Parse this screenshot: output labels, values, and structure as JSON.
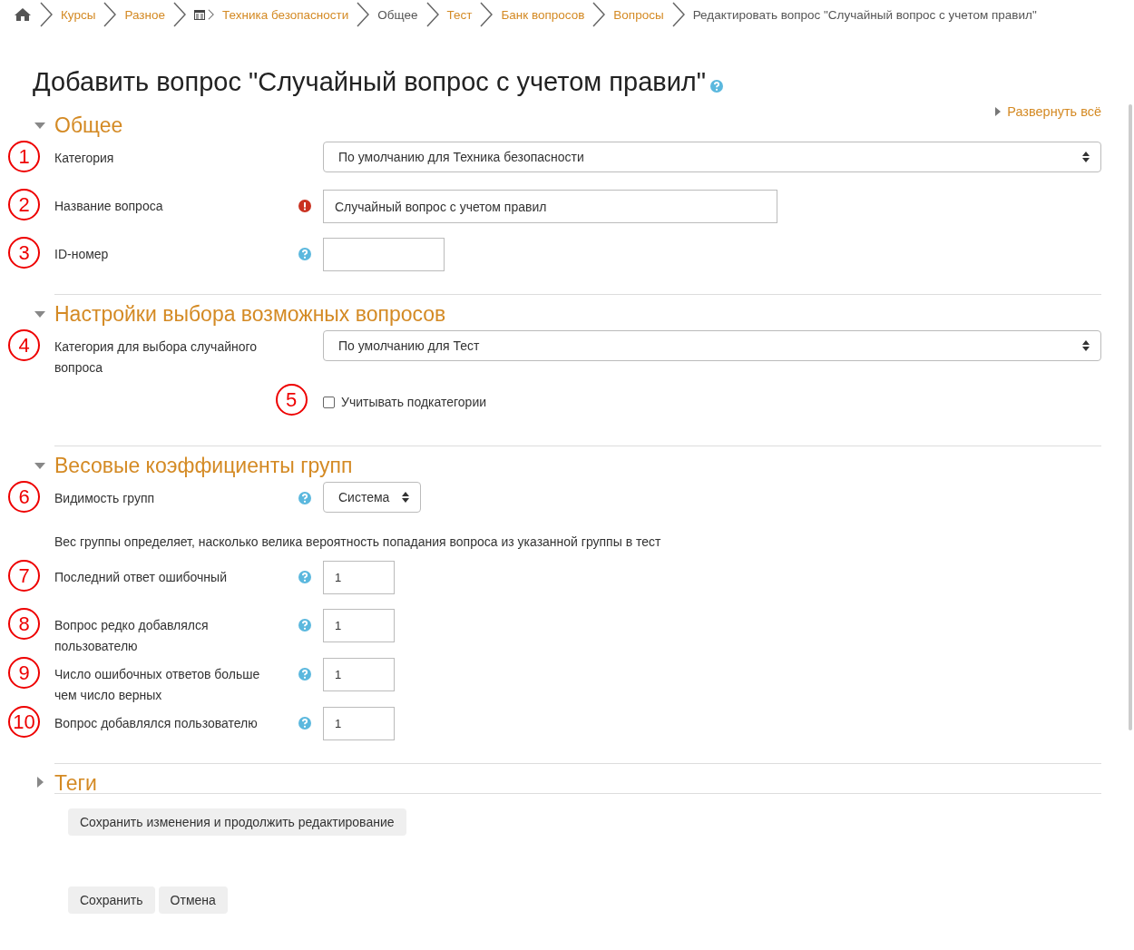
{
  "breadcrumb": [
    {
      "kind": "home"
    },
    {
      "kind": "link",
      "label": "Курсы"
    },
    {
      "kind": "link",
      "label": "Разное"
    },
    {
      "kind": "course",
      "label": "Техника безопасности"
    },
    {
      "kind": "text",
      "label": "Общее"
    },
    {
      "kind": "link",
      "label": "Тест"
    },
    {
      "kind": "link",
      "label": "Банк вопросов"
    },
    {
      "kind": "link",
      "label": "Вопросы"
    },
    {
      "kind": "text",
      "label": "Редактировать вопрос \"Случайный вопрос с учетом правил\""
    }
  ],
  "page_title": "Добавить вопрос \"Случайный вопрос с учетом правил\"",
  "expand_all": "Развернуть всё",
  "sections": [
    {
      "title": "Общее",
      "expanded": true,
      "rows": [
        {
          "kind": "select",
          "marker": "1",
          "label": "Категория",
          "value": "По умолчанию для Техника безопасности"
        },
        {
          "kind": "textfield",
          "marker": "2",
          "label": "Название вопроса",
          "required": true,
          "value": "Случайный вопрос с учетом правил"
        },
        {
          "kind": "idfield",
          "marker": "3",
          "label": "ID-номер",
          "help": true
        }
      ]
    },
    {
      "title": "Настройки выбора возможных вопросов",
      "expanded": true,
      "rows": [
        {
          "kind": "select",
          "marker": "4",
          "label": "Категория для выбора случайного вопроса",
          "value": "По умолчанию для Тест"
        },
        {
          "kind": "checkbox",
          "marker": "5",
          "label": "Учитывать подкатегории",
          "checked": false
        }
      ]
    },
    {
      "title": "Весовые коэффициенты групп",
      "expanded": true,
      "rows": [
        {
          "kind": "picker",
          "marker": "6",
          "label": "Видимость групп",
          "help": true,
          "value": "Система"
        },
        {
          "kind": "note",
          "label": "Вес группы определяет, насколько велика вероятность попадания вопроса из указанной группы в тест"
        },
        {
          "kind": "number",
          "marker": "7",
          "label": "Последний ответ ошибочный",
          "help": true,
          "value": "1"
        },
        {
          "kind": "number",
          "marker": "8",
          "label": "Вопрос редко добавлялся пользователю",
          "help": true,
          "value": "1"
        },
        {
          "kind": "number",
          "marker": "9",
          "label": "Число ошибочных ответов больше чем число верных",
          "help": true,
          "value": "1"
        },
        {
          "kind": "number",
          "marker": "10",
          "label": "Вопрос добавлялся пользователю",
          "help": true,
          "value": "1"
        }
      ]
    },
    {
      "title": "Теги",
      "expanded": false
    }
  ],
  "buttons_top": [
    "Сохранить изменения и продолжить редактирование"
  ],
  "buttons_bottom": [
    "Сохранить",
    "Отмена"
  ]
}
